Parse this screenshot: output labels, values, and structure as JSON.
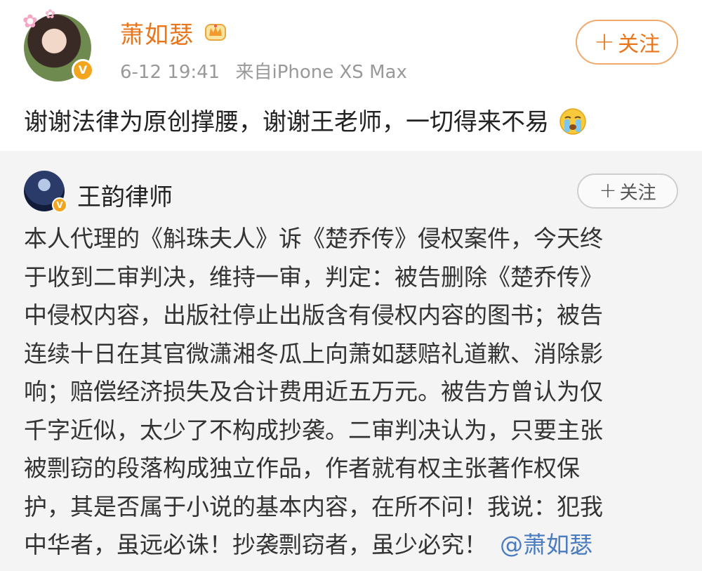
{
  "post": {
    "username": "萧如瑟",
    "verified_badge": "V",
    "timestamp": "6-12 19:41",
    "source": "来自iPhone XS Max",
    "follow_label": "关注",
    "follow_prefix": "+",
    "text": "谢谢法律为原创撑腰，谢谢王老师，一切得来不易",
    "emoji": "crying-face-emoji",
    "username_color": "#e8761d"
  },
  "repost": {
    "username": "王韵律师",
    "verified_badge": "V",
    "follow_label": "关注",
    "follow_prefix": "+",
    "lines": [
      "本人代理的《斛珠夫人》诉《楚乔传》侵权案件，今天终",
      "于收到二审判决，维持一审，判定：被告删除《楚乔传》",
      "中侵权内容，出版社停止出版含有侵权内容的图书；被告",
      "连续十日在其官微潇湘冬瓜上向萧如瑟赔礼道歉、消除影",
      "响；赔偿经济损失及合计费用近五万元。被告方曾认为仅",
      "千字近似，太少了不构成抄袭。二审判决认为，只要主张",
      "被剽窃的段落构成独立作品，作者就有权主张著作权保",
      "护，其是否属于小说的基本内容，在所不问！我说：犯我"
    ],
    "last_line": "中华者，虽远必诛！抄袭剽窃者，虽少必究！",
    "mention": "@萧如瑟",
    "mention_color": "#4a7cbf"
  }
}
